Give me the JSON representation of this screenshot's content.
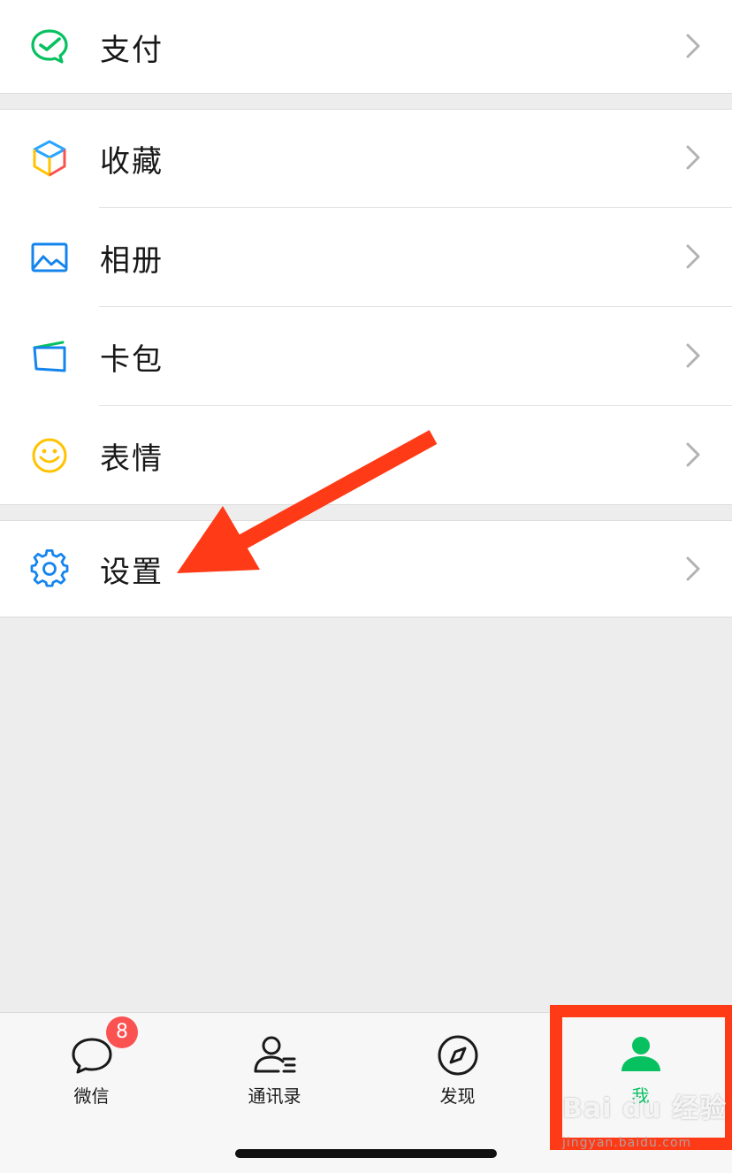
{
  "menu": {
    "pay": {
      "label": "支付",
      "icon": "wechat-pay-icon"
    },
    "favorites": {
      "label": "收藏",
      "icon": "cube-icon"
    },
    "album": {
      "label": "相册",
      "icon": "photo-icon"
    },
    "cards": {
      "label": "卡包",
      "icon": "wallet-icon"
    },
    "stickers": {
      "label": "表情",
      "icon": "smile-icon"
    },
    "settings": {
      "label": "设置",
      "icon": "gear-icon"
    }
  },
  "tabbar": {
    "tabs": [
      {
        "label": "微信",
        "icon": "chat-bubble-icon",
        "badge": "8"
      },
      {
        "label": "通讯录",
        "icon": "contacts-icon"
      },
      {
        "label": "发现",
        "icon": "compass-icon"
      },
      {
        "label": "我",
        "icon": "person-icon",
        "active": true
      }
    ]
  },
  "watermark": {
    "main": "Bai du 经验",
    "sub": "jingyan.baidu.com"
  },
  "colors": {
    "accent": "#07c160",
    "annotation": "#ff3a17",
    "badge": "#fa5151",
    "background": "#ededed"
  }
}
